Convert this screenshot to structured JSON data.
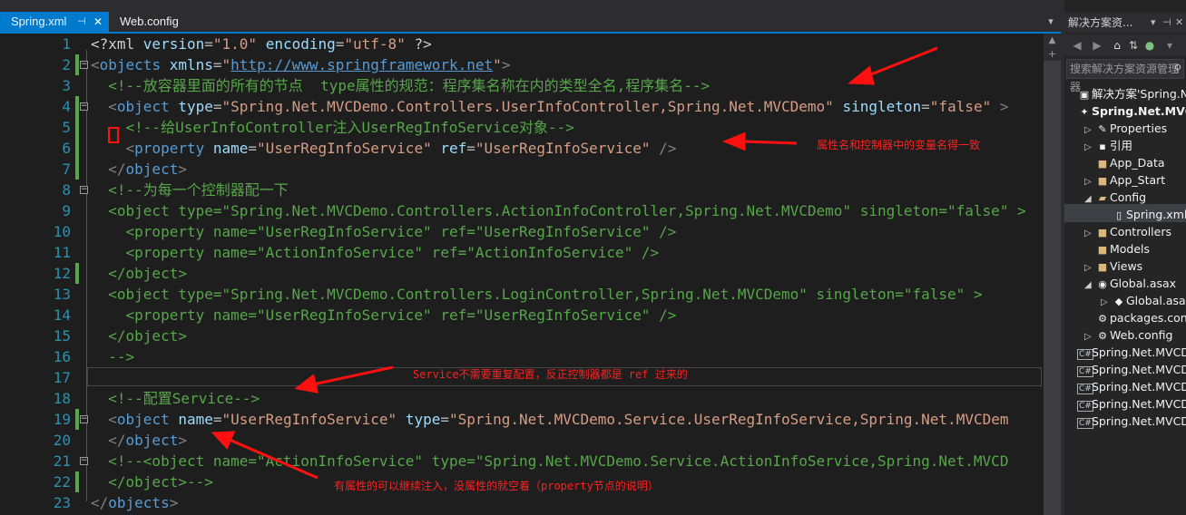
{
  "tabs": [
    {
      "label": "Spring.xml",
      "active": true,
      "pin_icon": "pin-icon",
      "close_icon": "close-icon"
    },
    {
      "label": "Web.config",
      "active": false
    }
  ],
  "editor": {
    "lines": [
      {
        "n": "1",
        "tokens": [
          [
            "pi",
            "<?xml "
          ],
          [
            "attr",
            "version"
          ],
          [
            "eq",
            "="
          ],
          [
            "val",
            "\"1.0\""
          ],
          [
            "pi",
            " "
          ],
          [
            "attr",
            "encoding"
          ],
          [
            "eq",
            "="
          ],
          [
            "val",
            "\"utf-8\""
          ],
          [
            "pi",
            " ?>"
          ]
        ]
      },
      {
        "n": "2",
        "tokens": [
          [
            "br",
            "<"
          ],
          [
            "tag",
            "objects"
          ],
          [
            "br",
            " "
          ],
          [
            "attr",
            "xmlns"
          ],
          [
            "eq",
            "="
          ],
          [
            "val",
            "\""
          ],
          [
            "lnk",
            "http://www.springframework.net"
          ],
          [
            "val",
            "\""
          ],
          [
            "br",
            ">"
          ]
        ]
      },
      {
        "n": "3",
        "tokens": [
          [
            "com",
            "  <!--放容器里面的所有的节点  type属性的规范：程序集名称在内的类型全名,程序集名-->"
          ]
        ]
      },
      {
        "n": "4",
        "tokens": [
          [
            "br",
            "  <"
          ],
          [
            "tag",
            "object"
          ],
          [
            "br",
            " "
          ],
          [
            "attr",
            "type"
          ],
          [
            "eq",
            "="
          ],
          [
            "val",
            "\"Spring.Net.MVCDemo.Controllers.UserInfoController,Spring.Net.MVCDemo\""
          ],
          [
            "br",
            " "
          ],
          [
            "attr",
            "singleton"
          ],
          [
            "eq",
            "="
          ],
          [
            "val",
            "\"false\""
          ],
          [
            "br",
            " >"
          ]
        ]
      },
      {
        "n": "5",
        "tokens": [
          [
            "com",
            "    <!--给UserInfoController注入UserRegInfoService对象-->"
          ]
        ]
      },
      {
        "n": "6",
        "tokens": [
          [
            "br",
            "    <"
          ],
          [
            "tag",
            "property"
          ],
          [
            "br",
            " "
          ],
          [
            "attr",
            "name"
          ],
          [
            "eq",
            "="
          ],
          [
            "val",
            "\"UserRegInfoService\""
          ],
          [
            "br",
            " "
          ],
          [
            "attr",
            "ref"
          ],
          [
            "eq",
            "="
          ],
          [
            "val",
            "\"UserRegInfoService\""
          ],
          [
            "br",
            " />"
          ]
        ]
      },
      {
        "n": "7",
        "tokens": [
          [
            "br",
            "  </"
          ],
          [
            "tag",
            "object"
          ],
          [
            "br",
            ">"
          ]
        ]
      },
      {
        "n": "8",
        "tokens": [
          [
            "com",
            "  <!--为每一个控制器配一下"
          ]
        ]
      },
      {
        "n": "9",
        "tokens": [
          [
            "com",
            "  <object type=\"Spring.Net.MVCDemo.Controllers.ActionInfoController,Spring.Net.MVCDemo\" singleton=\"false\" >"
          ]
        ]
      },
      {
        "n": "10",
        "tokens": [
          [
            "com",
            "    <property name=\"UserRegInfoService\" ref=\"UserRegInfoService\" />"
          ]
        ]
      },
      {
        "n": "11",
        "tokens": [
          [
            "com",
            "    <property name=\"ActionInfoService\" ref=\"ActionInfoService\" />"
          ]
        ]
      },
      {
        "n": "12",
        "tokens": [
          [
            "com",
            "  </object>"
          ]
        ]
      },
      {
        "n": "13",
        "tokens": [
          [
            "com",
            "  <object type=\"Spring.Net.MVCDemo.Controllers.LoginController,Spring.Net.MVCDemo\" singleton=\"false\" >"
          ]
        ]
      },
      {
        "n": "14",
        "tokens": [
          [
            "com",
            "    <property name=\"UserRegInfoService\" ref=\"UserRegInfoService\" />"
          ]
        ]
      },
      {
        "n": "15",
        "tokens": [
          [
            "com",
            "  </object>"
          ]
        ]
      },
      {
        "n": "16",
        "tokens": [
          [
            "com",
            "  -->"
          ]
        ]
      },
      {
        "n": "17",
        "tokens": []
      },
      {
        "n": "18",
        "tokens": [
          [
            "com",
            "  <!--配置Service-->"
          ]
        ]
      },
      {
        "n": "19",
        "tokens": [
          [
            "br",
            "  <"
          ],
          [
            "tag",
            "object"
          ],
          [
            "br",
            " "
          ],
          [
            "attr",
            "name"
          ],
          [
            "eq",
            "="
          ],
          [
            "val",
            "\"UserRegInfoService\""
          ],
          [
            "br",
            " "
          ],
          [
            "attr",
            "type"
          ],
          [
            "eq",
            "="
          ],
          [
            "val",
            "\"Spring.Net.MVCDemo.Service.UserRegInfoService,Spring.Net.MVCDem"
          ]
        ]
      },
      {
        "n": "20",
        "tokens": [
          [
            "br",
            "  </"
          ],
          [
            "tag",
            "object"
          ],
          [
            "br",
            ">"
          ]
        ]
      },
      {
        "n": "21",
        "tokens": [
          [
            "com",
            "  <!--<object name=\"ActionInfoService\" type=\"Spring.Net.MVCDemo.Service.ActionInfoService,Spring.Net.MVCD"
          ]
        ]
      },
      {
        "n": "22",
        "tokens": [
          [
            "com",
            "  </object>-->"
          ]
        ]
      },
      {
        "n": "23",
        "tokens": [
          [
            "br",
            "</"
          ],
          [
            "tag",
            "objects"
          ],
          [
            "br",
            ">"
          ]
        ]
      }
    ]
  },
  "annotations": {
    "property_note": "属性名和控制器中的变量名得一致",
    "service_note": "Service不需要重复配置，反正控制器都是 ref 过来的",
    "inherit_note": "有属性的可以继续注入，没属性的就空着（property节点的说明）"
  },
  "solution_explorer": {
    "title": "解决方案资...",
    "search_placeholder": "搜索解决方案资源管理器",
    "items": [
      {
        "label": "解决方案'Spring.Net.MVCDemo'",
        "indent": 0,
        "icon": "solution-icon",
        "bold": false
      },
      {
        "label": "Spring.Net.MVCDemo",
        "indent": 0,
        "icon": "project-icon",
        "bold": true
      },
      {
        "label": "Properties",
        "indent": 1,
        "icon": "wrench-icon",
        "arrow": "▷"
      },
      {
        "label": "引用",
        "indent": 1,
        "icon": "references-icon",
        "arrow": "▷"
      },
      {
        "label": "App_Data",
        "indent": 1,
        "icon": "folder-icon"
      },
      {
        "label": "App_Start",
        "indent": 1,
        "icon": "folder-icon",
        "arrow": "▷"
      },
      {
        "label": "Config",
        "indent": 1,
        "icon": "folder-open-icon",
        "arrow": "◢"
      },
      {
        "label": "Spring.xml",
        "indent": 2,
        "icon": "file-icon"
      },
      {
        "label": "Controllers",
        "indent": 1,
        "icon": "folder-icon",
        "arrow": "▷"
      },
      {
        "label": "Models",
        "indent": 1,
        "icon": "folder-icon"
      },
      {
        "label": "Views",
        "indent": 1,
        "icon": "folder-icon",
        "arrow": "▷"
      },
      {
        "label": "Global.asax",
        "indent": 1,
        "icon": "global-icon",
        "arrow": "◢"
      },
      {
        "label": "Global.asax.cs",
        "indent": 2,
        "icon": "cs-file-icon",
        "arrow": "▷"
      },
      {
        "label": "packages.config",
        "indent": 1,
        "icon": "config-icon"
      },
      {
        "label": "Web.config",
        "indent": 1,
        "icon": "config-icon",
        "arrow": "▷"
      },
      {
        "label": "Spring.Net.MVCDemo",
        "indent": 0,
        "icon": "csharp-project-icon"
      },
      {
        "label": "Spring.Net.MVCDemo",
        "indent": 0,
        "icon": "csharp-project-icon"
      },
      {
        "label": "Spring.Net.MVCDemo",
        "indent": 0,
        "icon": "csharp-project-icon"
      },
      {
        "label": "Spring.Net.MVCDemo",
        "indent": 0,
        "icon": "csharp-project-icon"
      },
      {
        "label": "Spring.Net.MVCDemo",
        "indent": 0,
        "icon": "csharp-project-icon"
      }
    ]
  },
  "colors": {
    "accent": "#007acc",
    "annotation": "#ff2020",
    "comment": "#57a64a"
  }
}
